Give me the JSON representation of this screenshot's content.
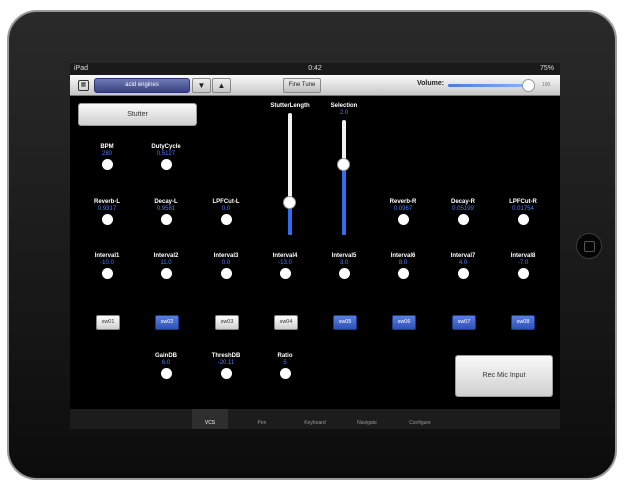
{
  "status_bar": {
    "carrier": "iPad",
    "time": "0:42",
    "battery": "75%"
  },
  "toolbar": {
    "preset": "acid engines",
    "up_arrow": "▼",
    "down_arrow": "▲",
    "fine_tune": "Fine Tune",
    "volume_label": "Volume:",
    "volume_value": "100",
    "volume_level": 0.95
  },
  "stutter_button": "Stutter",
  "sliders": {
    "stutter_length": {
      "label": "StutterLength",
      "value": "",
      "level": 0.27
    },
    "selection": {
      "label": "Selection",
      "value": "2.0",
      "level": 0.62
    }
  },
  "knobs": {
    "bpm": {
      "label": "BPM",
      "value": "280"
    },
    "duty_cycle": {
      "label": "DutyCycle",
      "value": "0.5127"
    },
    "reverb_l": {
      "label": "Reverb-L",
      "value": "0.9317"
    },
    "decay_l": {
      "label": "Decay-L",
      "value": "0.9581"
    },
    "lpfcut_l": {
      "label": "LPFCut-L",
      "value": "0.0"
    },
    "reverb_r": {
      "label": "Reverb-R",
      "value": "0.0967"
    },
    "decay_r": {
      "label": "Decay-R",
      "value": "0.05199"
    },
    "lpfcut_r": {
      "label": "LPFCut-R",
      "value": "0.01754"
    },
    "interval1": {
      "label": "Interval1",
      "value": "-10.0"
    },
    "interval2": {
      "label": "Interval2",
      "value": "11.0"
    },
    "interval3": {
      "label": "Interval3",
      "value": "0.0"
    },
    "interval4": {
      "label": "Interval4",
      "value": "-13.0"
    },
    "interval5": {
      "label": "Interval5",
      "value": "3.0"
    },
    "interval6": {
      "label": "Interval6",
      "value": "8.0"
    },
    "interval7": {
      "label": "Interval7",
      "value": "4.0"
    },
    "interval8": {
      "label": "Interval8",
      "value": "-7.0"
    },
    "gain_db": {
      "label": "GainDB",
      "value": "6.0"
    },
    "thresh_db": {
      "label": "ThreshDB",
      "value": "-20.11"
    },
    "ratio": {
      "label": "Ratio",
      "value": "5"
    }
  },
  "switches": [
    {
      "label": "sw01",
      "on": false
    },
    {
      "label": "sw02",
      "on": true
    },
    {
      "label": "sw03",
      "on": false
    },
    {
      "label": "sw04",
      "on": false
    },
    {
      "label": "sw05",
      "on": true
    },
    {
      "label": "sw06",
      "on": true
    },
    {
      "label": "sw07",
      "on": true
    },
    {
      "label": "sw08",
      "on": true
    }
  ],
  "rec_mic_button": "Rec Mic Input",
  "tabs": [
    {
      "label": "VCS",
      "selected": true
    },
    {
      "label": "Pen",
      "selected": false
    },
    {
      "label": "Keyboard",
      "selected": false
    },
    {
      "label": "Navigate",
      "selected": false
    },
    {
      "label": "Configure",
      "selected": false
    }
  ],
  "colors": {
    "accent": "#2f6cf0",
    "value_text": "#4d7cff",
    "background": "#000000"
  }
}
